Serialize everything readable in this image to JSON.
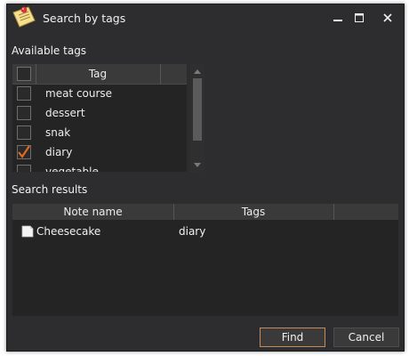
{
  "window": {
    "title": "Search by tags",
    "icon": "memo-pin-icon",
    "controls": [
      "minimize-icon",
      "maximize-icon",
      "close-icon"
    ]
  },
  "available_tags": {
    "label": "Available tags",
    "column_header": "Tag",
    "items": [
      {
        "label": "meat course",
        "checked": false
      },
      {
        "label": "dessert",
        "checked": false
      },
      {
        "label": "snak",
        "checked": false
      },
      {
        "label": "diary",
        "checked": true
      },
      {
        "label": "vegetable",
        "checked": false
      }
    ]
  },
  "search_results": {
    "label": "Search results",
    "columns": [
      "Note name",
      "Tags"
    ],
    "rows": [
      {
        "note_name": "Cheesecake",
        "tags": "diary",
        "icon": "note-icon"
      }
    ]
  },
  "buttons": {
    "find_label": "Find",
    "cancel_label": "Cancel"
  },
  "colors": {
    "background": "#2d2d30",
    "check_accent": "#e06a1f",
    "find_border": "#c88a5a"
  }
}
